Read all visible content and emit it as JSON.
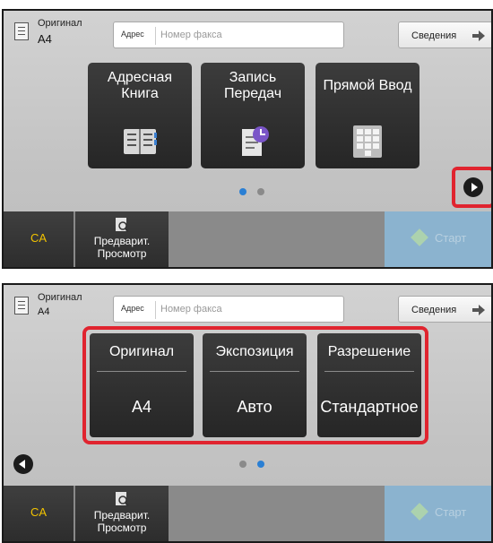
{
  "screen1": {
    "original": {
      "label": "Оригинал",
      "value": "A4"
    },
    "address": {
      "label": "Адрес",
      "placeholder": "Номер факса"
    },
    "details_label": "Сведения",
    "tiles": [
      {
        "label": "Адресная Книга",
        "icon": "address-book-icon"
      },
      {
        "label": "Запись Передач",
        "icon": "transmission-log-icon"
      },
      {
        "label": "Прямой Ввод",
        "icon": "keypad-icon"
      }
    ],
    "active_page": 1,
    "bottom": {
      "ca_label": "CA",
      "preview_label": "Предварит. Просмотр",
      "start_label": "Старт"
    }
  },
  "screen2": {
    "original": {
      "label": "Оригинал",
      "value": "A4"
    },
    "address": {
      "label": "Адрес",
      "placeholder": "Номер факса"
    },
    "details_label": "Сведения",
    "settings": [
      {
        "label": "Оригинал",
        "value": "A4"
      },
      {
        "label": "Экспозиция",
        "value": "Авто"
      },
      {
        "label": "Разрешение",
        "value": "Стандартное"
      }
    ],
    "active_page": 2,
    "bottom": {
      "ca_label": "CA",
      "preview_label": "Предварит. Просмотр",
      "start_label": "Старт"
    }
  },
  "colors": {
    "highlight": "#e0242f",
    "page_dot_active": "#2a7fd4",
    "page_dot_inactive": "#8a8a8a",
    "ca_text": "#f2c300",
    "start_button": "#8bb3cf"
  }
}
